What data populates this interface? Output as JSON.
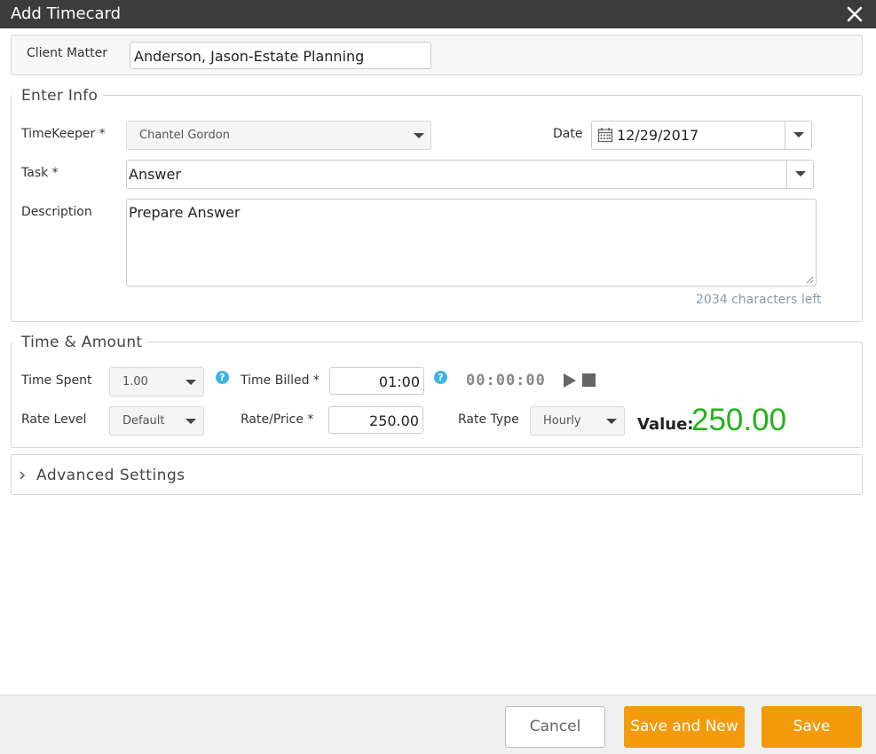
{
  "dialog": {
    "title": "Add Timecard"
  },
  "client_matter": {
    "label": "Client Matter",
    "value": "Anderson, Jason-Estate Planning"
  },
  "enter_info": {
    "legend": "Enter Info",
    "timekeeper": {
      "label": "TimeKeeper *",
      "value": "Chantel Gordon"
    },
    "date": {
      "label": "Date",
      "value": "12/29/2017"
    },
    "task": {
      "label": "Task *",
      "value": "Answer"
    },
    "description": {
      "label": "Description",
      "value": "Prepare Answer",
      "chars_left": "2034 characters left"
    }
  },
  "time_amount": {
    "legend": "Time & Amount",
    "time_spent": {
      "label": "Time Spent",
      "value": "1.00"
    },
    "time_billed": {
      "label": "Time Billed *",
      "value": "01:00"
    },
    "timer": {
      "display": "00:00:00"
    },
    "rate_level": {
      "label": "Rate Level",
      "value": "Default"
    },
    "rate_price": {
      "label": "Rate/Price *",
      "value": "250.00"
    },
    "rate_type": {
      "label": "Rate Type",
      "value": "Hourly"
    },
    "value": {
      "label": "Value:",
      "amount": "250.00"
    }
  },
  "advanced": {
    "label": "Advanced Settings"
  },
  "footer": {
    "cancel_label": "Cancel",
    "save_new_label": "Save and New",
    "save_label": "Save"
  },
  "colors": {
    "accent": "#f49b0b",
    "value_green": "#22b21a",
    "help_blue": "#3bb4e5",
    "titlebar": "#3c3c3c"
  },
  "icons": [
    "close-icon",
    "calendar-icon",
    "chevron-down-icon",
    "help-icon",
    "play-icon",
    "stop-icon",
    "chevron-right-icon"
  ]
}
